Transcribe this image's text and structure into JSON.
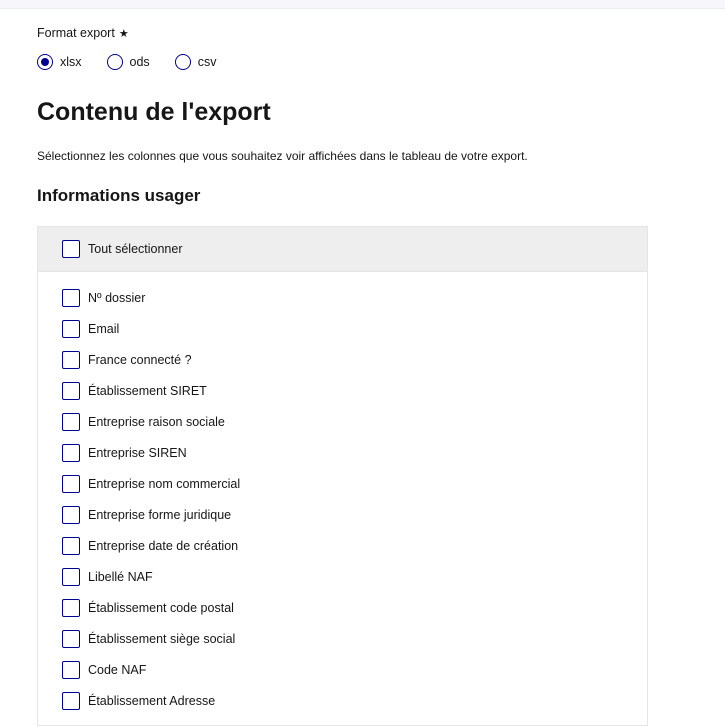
{
  "format": {
    "label": "Format export",
    "required_mark": "★",
    "options": [
      {
        "label": "xlsx",
        "selected": true
      },
      {
        "label": "ods",
        "selected": false
      },
      {
        "label": "csv",
        "selected": false
      }
    ],
    "accent_color": "#000091"
  },
  "content": {
    "title": "Contenu de l'export",
    "description": "Sélectionnez les colonnes que vous souhaitez voir affichées dans le tableau de votre export."
  },
  "usager": {
    "title": "Informations usager",
    "select_all_label": "Tout sélectionner",
    "items": [
      {
        "label": "Nº dossier",
        "checked": false
      },
      {
        "label": "Email",
        "checked": false
      },
      {
        "label": "France connecté ?",
        "checked": false
      },
      {
        "label": "Établissement SIRET",
        "checked": false
      },
      {
        "label": "Entreprise raison sociale",
        "checked": false
      },
      {
        "label": "Entreprise SIREN",
        "checked": false
      },
      {
        "label": "Entreprise nom commercial",
        "checked": false
      },
      {
        "label": "Entreprise forme juridique",
        "checked": false
      },
      {
        "label": "Entreprise date de création",
        "checked": false
      },
      {
        "label": "Libellé NAF",
        "checked": false
      },
      {
        "label": "Établissement code postal",
        "checked": false
      },
      {
        "label": "Établissement siège social",
        "checked": false
      },
      {
        "label": "Code NAF",
        "checked": false
      },
      {
        "label": "Établissement Adresse",
        "checked": false
      }
    ]
  }
}
